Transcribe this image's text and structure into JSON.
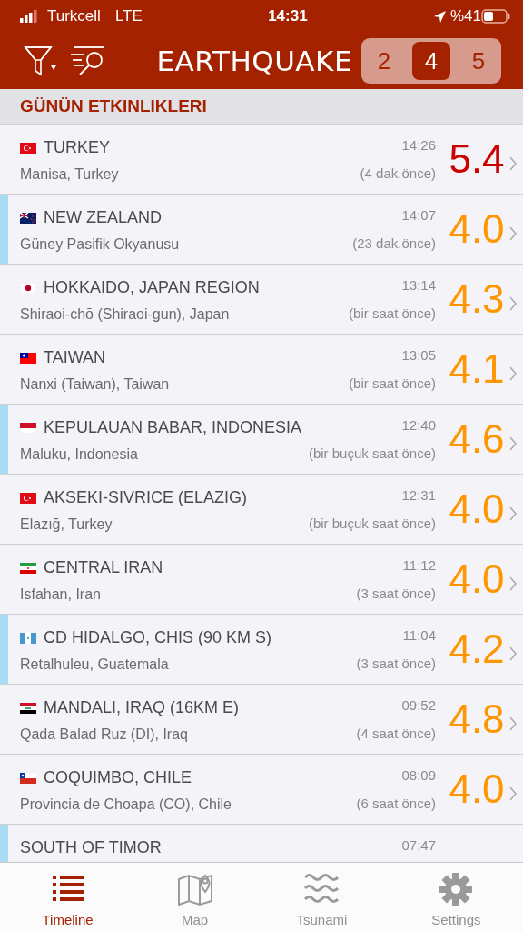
{
  "status_bar": {
    "carrier": "Turkcell",
    "network": "LTE",
    "time": "14:31",
    "battery": "%41"
  },
  "header": {
    "title": "EARTHQUAKE",
    "magnitude_filter": [
      {
        "label": "2",
        "selected": false
      },
      {
        "label": "4",
        "selected": true
      },
      {
        "label": "5",
        "selected": false
      }
    ]
  },
  "section": {
    "title": "GÜNÜN ETKINLIKLERI"
  },
  "rows": [
    {
      "kind": "tr",
      "title": "TURKEY",
      "place": "Manisa, Turkey",
      "time": "14:26",
      "ago": "(4 dak.önce)",
      "magnitude": "5.4",
      "color": "#cc0000",
      "highlighted": false
    },
    {
      "kind": "nz",
      "title": "NEW ZEALAND",
      "place": "Güney Pasifik Okyanusu",
      "time": "14:07",
      "ago": "(23 dak.önce)",
      "magnitude": "4.0",
      "color": "#ff9500",
      "highlighted": true
    },
    {
      "kind": "jp",
      "title": "HOKKAIDO, JAPAN REGION",
      "place": "Shiraoi-chō (Shiraoi-gun), Japan",
      "time": "13:14",
      "ago": "(bir saat önce)",
      "magnitude": "4.3",
      "color": "#ff9500",
      "highlighted": false
    },
    {
      "kind": "tw",
      "title": "TAIWAN",
      "place": "Nanxi (Taiwan), Taiwan",
      "time": "13:05",
      "ago": "(bir saat önce)",
      "magnitude": "4.1",
      "color": "#ff9500",
      "highlighted": false
    },
    {
      "kind": "id",
      "title": "KEPULAUAN BABAR, INDONESIA",
      "place": "Maluku, Indonesia",
      "time": "12:40",
      "ago": "(bir buçuk saat önce)",
      "magnitude": "4.6",
      "color": "#ff9500",
      "highlighted": true
    },
    {
      "kind": "tr",
      "title": "AKSEKI-SIVRICE (ELAZIG)",
      "place": "Elazığ, Turkey",
      "time": "12:31",
      "ago": "(bir buçuk saat önce)",
      "magnitude": "4.0",
      "color": "#ff9500",
      "highlighted": false
    },
    {
      "kind": "ir",
      "title": "CENTRAL IRAN",
      "place": "Isfahan, Iran",
      "time": "11:12",
      "ago": "(3 saat önce)",
      "magnitude": "4.0",
      "color": "#ff9500",
      "highlighted": false
    },
    {
      "kind": "gt",
      "title": "CD HIDALGO, CHIS (90 KM S)",
      "place": "Retalhuleu, Guatemala",
      "time": "11:04",
      "ago": "(3 saat önce)",
      "magnitude": "4.2",
      "color": "#ff9500",
      "highlighted": true
    },
    {
      "kind": "iq",
      "title": "MANDALI, IRAQ (16KM E)",
      "place": "Qada Balad Ruz (DI), Iraq",
      "time": "09:52",
      "ago": "(4 saat önce)",
      "magnitude": "4.8",
      "color": "#ff9500",
      "highlighted": false
    },
    {
      "kind": "cl",
      "title": "COQUIMBO, CHILE",
      "place": "Provincia de Choapa (CO), Chile",
      "time": "08:09",
      "ago": "(6 saat önce)",
      "magnitude": "4.0",
      "color": "#ff9500",
      "highlighted": false
    },
    {
      "title": "SOUTH OF TIMOR",
      "time": "07:47",
      "highlighted": true
    }
  ],
  "tab_bar": [
    {
      "label": "Timeline",
      "kind": "list",
      "selected": true
    },
    {
      "label": "Map",
      "kind": "map",
      "selected": false
    },
    {
      "label": "Tsunami",
      "kind": "waves",
      "selected": false
    },
    {
      "label": "Settings",
      "kind": "gear",
      "selected": false
    }
  ]
}
